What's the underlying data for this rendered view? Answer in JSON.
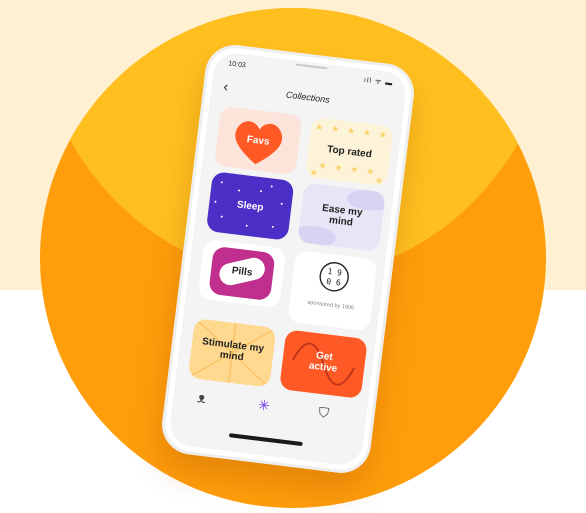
{
  "status": {
    "time": "10:03",
    "icons": "ıll ᯤ ▬"
  },
  "nav": {
    "back": "‹",
    "title": "Collections"
  },
  "tiles": {
    "favs": "Favs",
    "top_rated": "Top rated",
    "sleep": "Sleep",
    "ease": "Ease my mind",
    "pills": "Pills",
    "sponsor_logo_top": "1 9",
    "sponsor_logo_bottom": "0 6",
    "sponsor_text": "sponsored by 1906",
    "stimulate": "Stimulate my mind",
    "active": "Get active"
  },
  "tabs": [
    {
      "icon": "ribbon-icon",
      "glyph": "ᴥ"
    },
    {
      "icon": "asterisk-icon",
      "glyph": "✳"
    },
    {
      "icon": "bag-icon",
      "glyph": "⛉"
    }
  ],
  "colors": {
    "accent": "#6a36e8",
    "orange": "#ff9d0b",
    "yellow": "#ffc01f"
  }
}
